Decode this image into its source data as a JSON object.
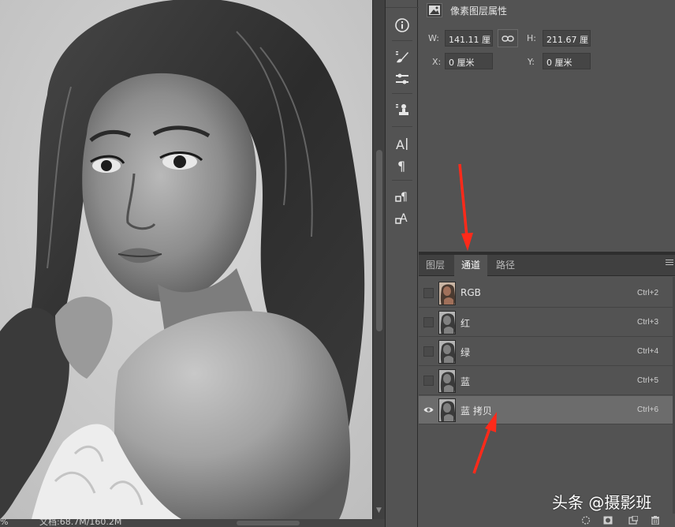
{
  "document": {
    "zoom_fragment": "%",
    "doc_info": "文档:68.7M/160.2M"
  },
  "properties_panel": {
    "title": "像素图层属性",
    "w_label": "W:",
    "w_value": "141.11 厘",
    "h_label": "H:",
    "h_value": "211.67 厘",
    "x_label": "X:",
    "x_value": "0 厘米",
    "y_label": "Y:",
    "y_value": "0 厘米"
  },
  "tabs": [
    {
      "label": "图层",
      "active": false
    },
    {
      "label": "通道",
      "active": true
    },
    {
      "label": "路径",
      "active": false
    }
  ],
  "channels": [
    {
      "name": "RGB",
      "shortcut": "Ctrl+2",
      "visible": false,
      "selected": false,
      "color_thumb": true
    },
    {
      "name": "红",
      "shortcut": "Ctrl+3",
      "visible": false,
      "selected": false,
      "color_thumb": false
    },
    {
      "name": "绿",
      "shortcut": "Ctrl+4",
      "visible": false,
      "selected": false,
      "color_thumb": false
    },
    {
      "name": "蓝",
      "shortcut": "Ctrl+5",
      "visible": false,
      "selected": false,
      "color_thumb": false
    },
    {
      "name": "蓝 拷贝",
      "shortcut": "Ctrl+6",
      "visible": true,
      "selected": true,
      "color_thumb": false
    }
  ],
  "watermark": "头条 @摄影班",
  "icons": {
    "strip": [
      "info-icon",
      "brush-settings-icon",
      "adjustments-icon",
      "clone-source-icon",
      "character-icon",
      "paragraph-icon",
      "paragraph-styles-icon",
      "character-styles-icon"
    ],
    "footer": [
      "load-selection-icon",
      "save-selection-icon",
      "new-channel-icon",
      "delete-icon"
    ]
  },
  "colors": {
    "panel_bg": "#535353",
    "selected_row": "#6c6c6c",
    "annotation_arrow": "#ff2a1a"
  }
}
